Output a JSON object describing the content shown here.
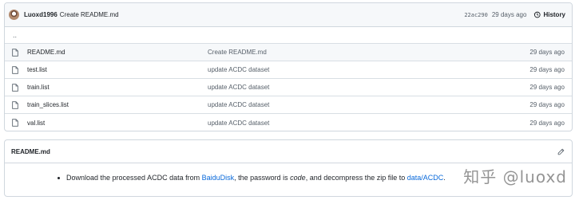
{
  "commit": {
    "author": "Luoxd1996",
    "message": "Create README.md",
    "sha": "22ac290",
    "age": "29 days ago",
    "history_label": "History"
  },
  "parent_dir": "..",
  "files": [
    {
      "name": "README.md",
      "commit": "Create README.md",
      "age": "29 days ago"
    },
    {
      "name": "test.list",
      "commit": "update ACDC dataset",
      "age": "29 days ago"
    },
    {
      "name": "train.list",
      "commit": "update ACDC dataset",
      "age": "29 days ago"
    },
    {
      "name": "train_slices.list",
      "commit": "update ACDC dataset",
      "age": "29 days ago"
    },
    {
      "name": "val.list",
      "commit": "update ACDC dataset",
      "age": "29 days ago"
    }
  ],
  "readme": {
    "title": "README.md",
    "text1": "Download the processed ACDC data from ",
    "link1": "BaiduDisk",
    "text2": ", the password is ",
    "em": "code",
    "text3": ", and decompress the zip file to ",
    "link2": "data/ACDC",
    "text4": "."
  },
  "watermark": "知乎 @luoxd",
  "colors": {
    "link": "#0969da",
    "muted": "#57606a",
    "border": "#d0d7de"
  },
  "icons": {
    "file": "file-icon",
    "history": "history-icon",
    "edit": "pencil-icon"
  }
}
